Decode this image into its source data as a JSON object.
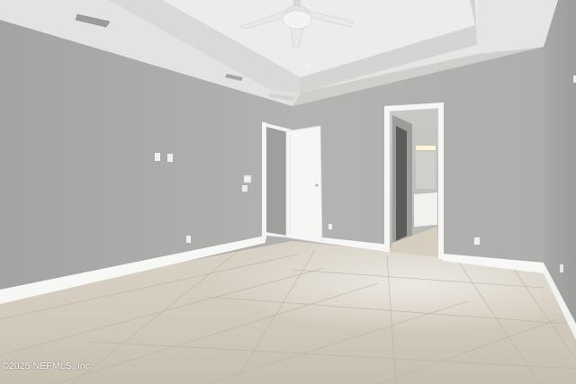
{
  "photo": {
    "watermark": "©2025 NEFMLS, Inc"
  },
  "colors": {
    "wall": "#a9aaa8",
    "ceiling": "#e6e6e4",
    "trim": "#f7f7f5",
    "floor": "#d3cbbd"
  }
}
